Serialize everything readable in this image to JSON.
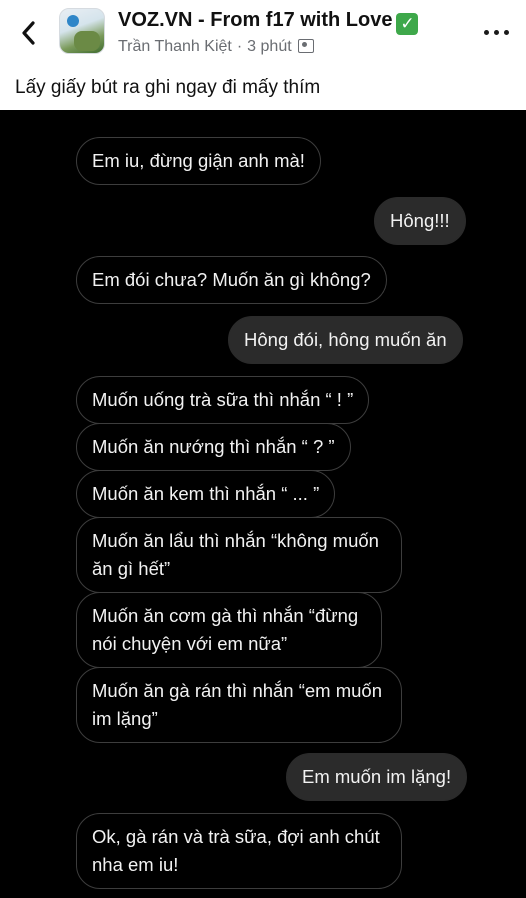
{
  "header": {
    "group_name": "VOZ.VN - From f17 with Love",
    "verified_glyph": "✓",
    "author": "Trần Thanh Kiệt",
    "separator": "·",
    "time": "3 phút",
    "back_icon": "chevron-left-icon",
    "more_icon": "ellipsis-icon",
    "group_icon": "group-icon"
  },
  "post": {
    "caption": "Lấy giấy bút ra ghi ngay đi mấy thím"
  },
  "chat": {
    "messages": [
      {
        "side": "left",
        "text": "Em iu, đừng giận anh mà!"
      },
      {
        "side": "right",
        "text": "Hông!!!"
      },
      {
        "side": "left",
        "text": "Em đói chưa? Muốn ăn gì không?"
      },
      {
        "side": "right",
        "text": "Hông đói, hông muốn ăn"
      },
      {
        "side": "left",
        "text": "Muốn uống trà sữa thì nhắn “ ! ”"
      },
      {
        "side": "left",
        "text": "Muốn ăn nướng thì nhắn “ ? ”"
      },
      {
        "side": "left",
        "text": "Muốn ăn kem thì nhắn “ ... ”"
      },
      {
        "side": "left",
        "line1": "Muốn ăn lẩu thì nhắn “không muốn",
        "line2": "ăn gì hết”"
      },
      {
        "side": "left",
        "line1": "Muốn ăn cơm gà thì nhắn “đừng",
        "line2": "nói chuyện với em nữa”"
      },
      {
        "side": "left",
        "line1": "Muốn ăn gà rán thì nhắn “em muốn",
        "line2": "im lặng”"
      },
      {
        "side": "right",
        "text": "Em muốn im lặng!"
      },
      {
        "side": "left",
        "line1": "Ok, gà rán và trà sữa, đợi anh chút",
        "line2": "nha em iu!"
      }
    ]
  }
}
